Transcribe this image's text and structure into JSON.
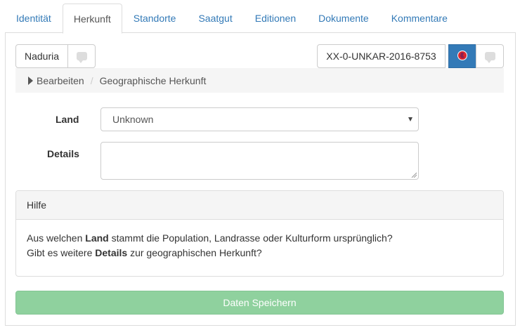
{
  "tabs": [
    {
      "label": "Identität"
    },
    {
      "label": "Herkunft",
      "active": true
    },
    {
      "label": "Standorte"
    },
    {
      "label": "Saatgut"
    },
    {
      "label": "Editionen"
    },
    {
      "label": "Dokumente"
    },
    {
      "label": "Kommentare"
    }
  ],
  "toolbar": {
    "name_button": "Naduria",
    "accession_id": "XX-0-UNKAR-2016-8753",
    "flag_color": "#337ab7"
  },
  "breadcrumb": {
    "edit": "Bearbeiten",
    "separator": "/",
    "current": "Geographische Herkunft"
  },
  "form": {
    "land_label": "Land",
    "land_value": "Unknown",
    "details_label": "Details",
    "details_value": ""
  },
  "help": {
    "title": "Hilfe",
    "line1_prefix": "Aus welchen ",
    "line1_bold": "Land",
    "line1_suffix": " stammt die Population, Landrasse oder Kulturform ursprünglich?",
    "line2_prefix": "Gibt es weitere ",
    "line2_bold": "Details",
    "line2_suffix": " zur geographischen Herkunft?"
  },
  "save_button": "Daten Speichern"
}
